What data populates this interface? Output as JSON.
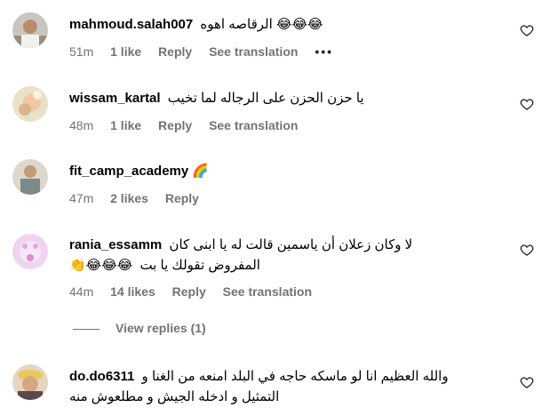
{
  "comments": [
    {
      "username": "mahmoud.salah007",
      "text": "الرقاصه اهوه",
      "emojis": "😂😂😂",
      "time": "51m",
      "likes": "1 like",
      "reply": "Reply",
      "translation": "See translation",
      "more": "•••"
    },
    {
      "username": "wissam_kartal",
      "text": "يا حزن الحزن على الرجاله لما تخيب",
      "time": "48m",
      "likes": "1 like",
      "reply": "Reply",
      "translation": "See translation"
    },
    {
      "username": "fit_camp_academy",
      "emojis": "🌈",
      "time": "47m",
      "likes": "2 likes",
      "reply": "Reply"
    },
    {
      "username": "rania_essamm",
      "text": "لا وكان زعلان أن ياسمين قالت له يا ابنى كان",
      "text2": "المفروض تقولك يا بت",
      "emojis2": "👏😂😂😂",
      "time": "44m",
      "likes": "14 likes",
      "reply": "Reply",
      "translation": "See translation"
    },
    {
      "username": "do.do6311",
      "text": "والله العظيم انا لو ماسكه حاجه في البلد امنعه من الغنا و",
      "text2": "التمثيل و ادخله الجيش و مطلعوش منه"
    }
  ],
  "view_replies": "View replies (1)",
  "icons": {
    "like": "heart-outline-icon",
    "more": "more-options-icon"
  },
  "colors": {
    "secondary_text": "#737373",
    "primary_text": "#000000"
  }
}
